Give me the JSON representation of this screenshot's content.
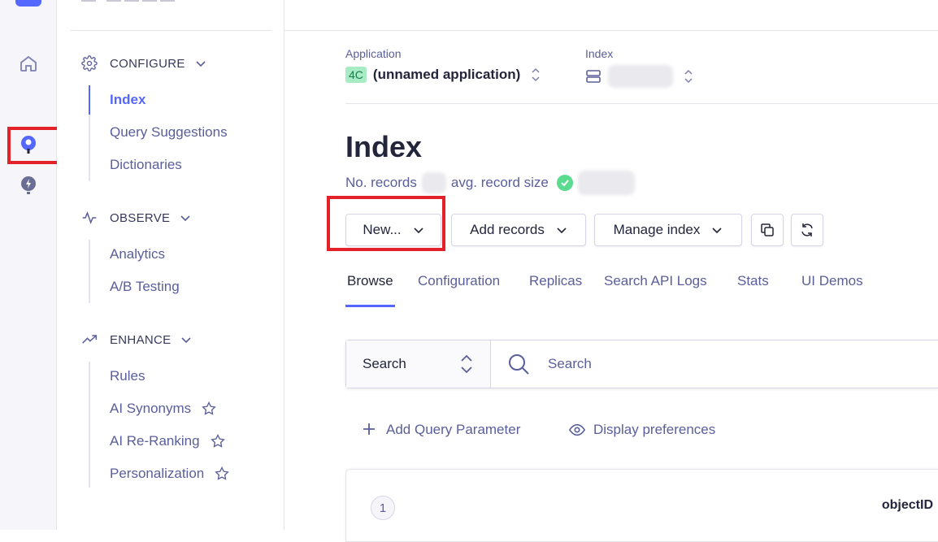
{
  "sidebar": {
    "sections": [
      {
        "title": "CONFIGURE",
        "items": [
          "Index",
          "Query Suggestions",
          "Dictionaries"
        ]
      },
      {
        "title": "OBSERVE",
        "items": [
          "Analytics",
          "A/B Testing"
        ]
      },
      {
        "title": "ENHANCE",
        "items": [
          "Rules",
          "AI Synonyms",
          "AI Re-Ranking",
          "Personalization"
        ]
      }
    ]
  },
  "header": {
    "application_label": "Application",
    "application_badge": "4C",
    "application_name": "(unnamed application)",
    "index_label": "Index"
  },
  "page": {
    "title": "Index",
    "records_label": "No. records",
    "size_label": "avg. record size"
  },
  "toolbar": {
    "new_label": "New...",
    "add_records_label": "Add records",
    "manage_index_label": "Manage index"
  },
  "tabs": [
    "Browse",
    "Configuration",
    "Replicas",
    "Search API Logs",
    "Stats",
    "UI Demos"
  ],
  "search": {
    "mode": "Search",
    "placeholder": "Search"
  },
  "actions": {
    "add_query_param": "Add Query Parameter",
    "display_prefs": "Display preferences"
  },
  "results": {
    "page_number": "1",
    "column_header": "objectID"
  },
  "colors": {
    "accent": "#5468ff",
    "highlight": "#e32128",
    "success": "#5adb8f"
  }
}
